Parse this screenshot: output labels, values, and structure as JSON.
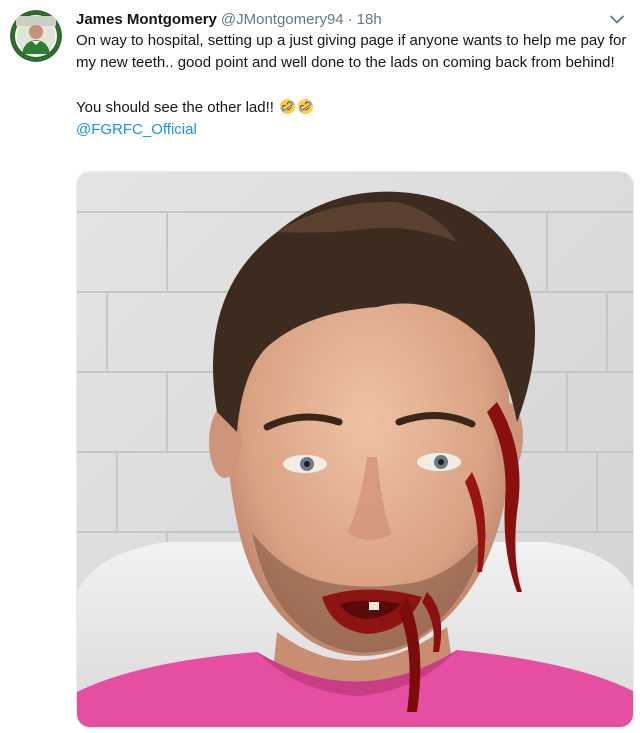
{
  "tweet": {
    "author": {
      "display_name": "James Montgomery",
      "handle": "@JMontgomery94",
      "avatar_icon": "profile-photo-icon"
    },
    "separator": "·",
    "timestamp": "18h",
    "menu_icon": "chevron-down-icon",
    "text_line_1": "On way to hospital, setting up a just giving page if anyone wants to help me pay for my new teeth.. good point and well done to the lads on coming back from behind!",
    "text_line_2": "You should see the other lad!!",
    "emoji_icons": [
      "rolling-on-floor-laughing-icon",
      "rolling-on-floor-laughing-icon"
    ],
    "mention": "@FGRFC_Official",
    "media": {
      "type": "photo",
      "icon": "photo-icon"
    }
  },
  "colors": {
    "text": "#14171a",
    "secondary": "#657786",
    "link": "#1b95e0"
  }
}
